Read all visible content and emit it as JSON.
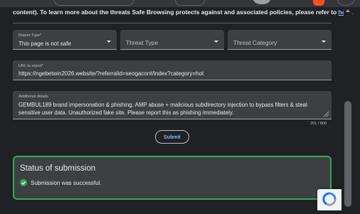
{
  "intro": {
    "text": "content). To learn more about the threats Safe Browsing protects against and associated policies, please refer to ",
    "link": "here",
    "end": "."
  },
  "form": {
    "report_type": {
      "label": "Report Type*",
      "value": "This page is not safe"
    },
    "threat_type": {
      "placeholder": "Threat Type"
    },
    "threat_category": {
      "placeholder": "Threat Category"
    },
    "url": {
      "label": "URL to report*",
      "value": "https://ngebetwin2026.website/?referralid=seogacor#/index?category=hot"
    },
    "details": {
      "label": "Additional details",
      "value": "GEMBUL189 brand impersonation & phishing. AMP abuse + malicious subdirectory injection to bypass filters & steal sensitive user data. Unauthorized fake site. Please report this as phishing immediately.",
      "counter": "201 / 800"
    },
    "submit_label": "Submit"
  },
  "status": {
    "title": "Status of submission",
    "message": "Submission was successful."
  },
  "colors": {
    "accent": "#8ab4f8",
    "success": "#34a853",
    "background": "#202124",
    "field": "#3c4043"
  },
  "icons": [
    "check-circle-icon",
    "chevron-down-icon",
    "recaptcha-icon"
  ]
}
